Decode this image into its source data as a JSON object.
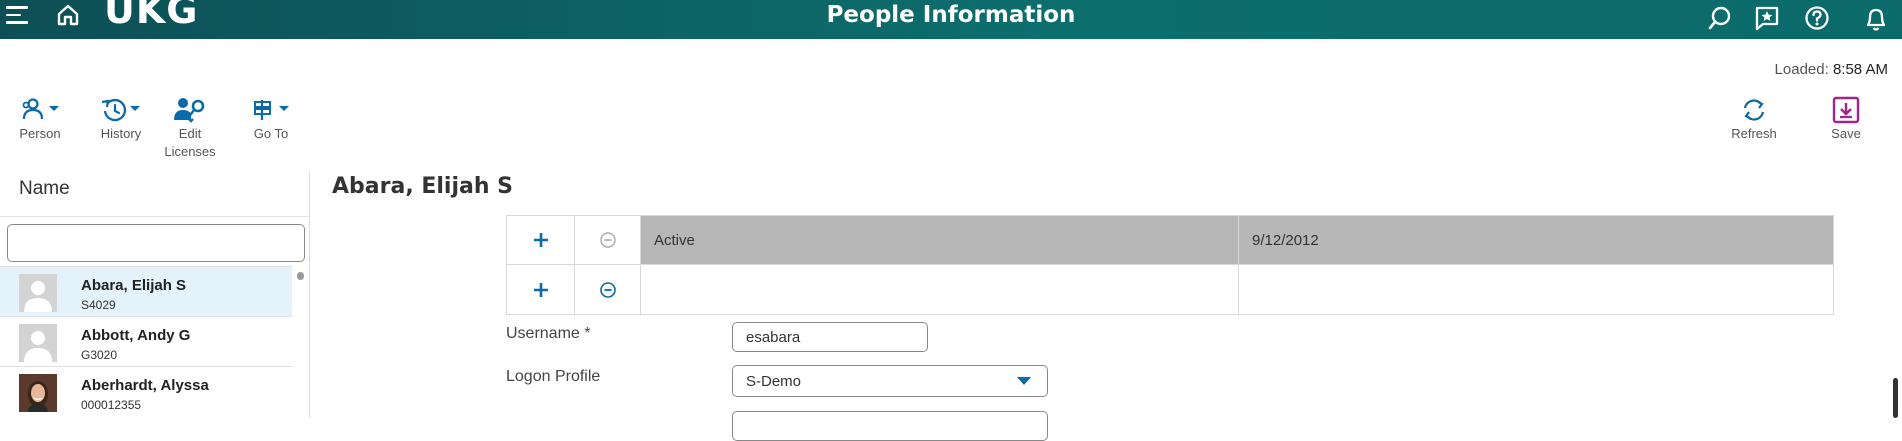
{
  "header": {
    "logo": "UKG",
    "title": "People Information"
  },
  "loaded": {
    "label": "Loaded:",
    "time": "8:58 AM"
  },
  "toolbar": {
    "person": "Person",
    "history": "History",
    "edit_licenses_1": "Edit",
    "edit_licenses_2": "Licenses",
    "goto": "Go To",
    "refresh": "Refresh",
    "save": "Save"
  },
  "colors": {
    "accent": "#0b6aa8",
    "save": "#a2238c",
    "header": "#0d6e6e"
  },
  "left": {
    "name_header": "Name",
    "search_value": "",
    "people": [
      {
        "name": "Abara, Elijah S",
        "id": "S4029"
      },
      {
        "name": "Abbott, Andy G",
        "id": "G3020"
      },
      {
        "name": "Aberhardt, Alyssa",
        "id": "000012355"
      }
    ]
  },
  "main": {
    "person_title": "Abara, Elijah S",
    "grid": [
      {
        "status": "Active",
        "date": "9/12/2012"
      },
      {
        "status": "",
        "date": ""
      }
    ],
    "username_label": "Username *",
    "username_value": "esabara",
    "logon_label": "Logon Profile",
    "logon_value": "S-Demo"
  }
}
